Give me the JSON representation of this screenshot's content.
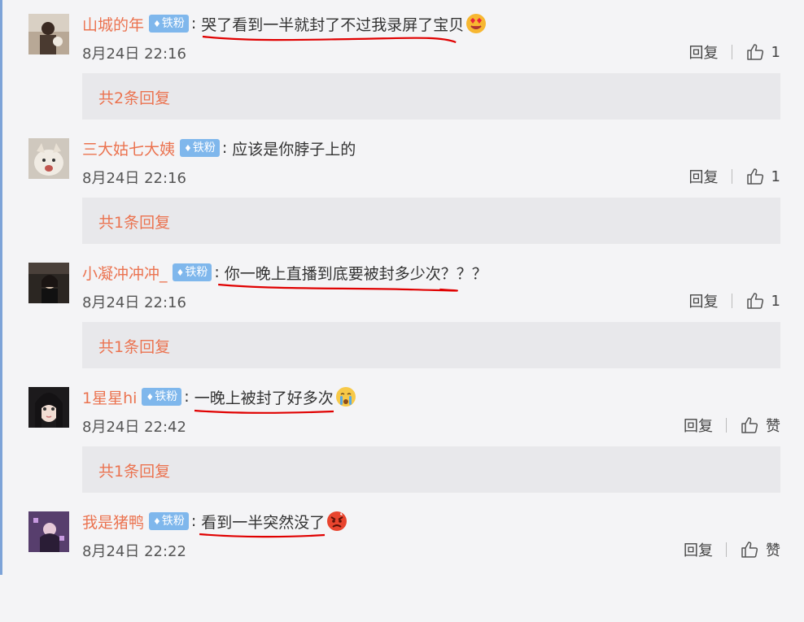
{
  "comments": [
    {
      "username": "山城的年",
      "badge": "铁粉",
      "text": "哭了看到一半就封了不过我录屏了宝贝",
      "emoji": "heart-eyes-emoji",
      "time": "8月24日 22:16",
      "reply_label": "回复",
      "like_label": "1",
      "more_replies": "共2条回复"
    },
    {
      "username": "三大姑七大姨",
      "badge": "铁粉",
      "text": "应该是你脖子上的",
      "emoji": "",
      "time": "8月24日 22:16",
      "reply_label": "回复",
      "like_label": "1",
      "more_replies": "共1条回复"
    },
    {
      "username": "小凝冲冲冲_",
      "badge": "铁粉",
      "text": "你一晚上直播到底要被封多少次？？？",
      "emoji": "",
      "time": "8月24日 22:16",
      "reply_label": "回复",
      "like_label": "1",
      "more_replies": "共1条回复"
    },
    {
      "username": "1星星hi",
      "badge": "铁粉",
      "text": "一晚上被封了好多次",
      "emoji": "crying-emoji",
      "time": "8月24日 22:42",
      "reply_label": "回复",
      "like_label": "赞",
      "more_replies": "共1条回复"
    },
    {
      "username": "我是猪鸭",
      "badge": "铁粉",
      "text": "看到一半突然没了",
      "emoji": "angry-emoji",
      "time": "8月24日 22:22",
      "reply_label": "回复",
      "like_label": "赞",
      "more_replies": ""
    }
  ],
  "colors": {
    "username": "#eb7350",
    "badge_bg": "#7fb7ec",
    "underline": "#e00000",
    "background": "#f4f4f6",
    "more_box": "#e8e8eb"
  }
}
